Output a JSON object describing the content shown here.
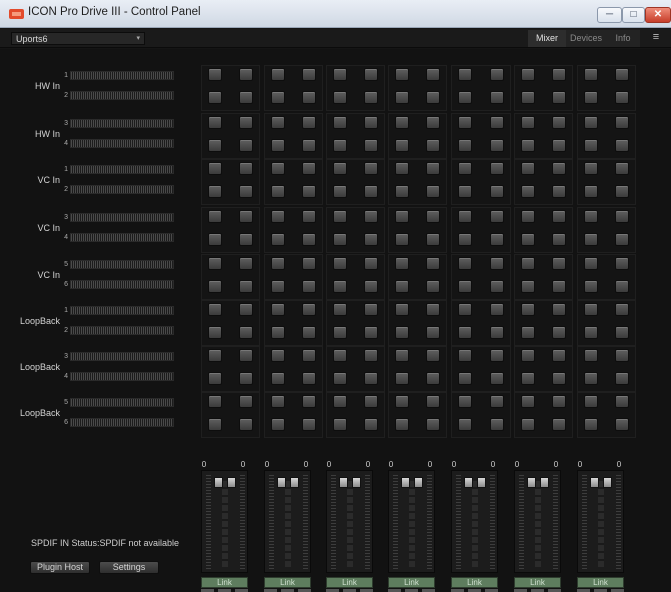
{
  "window": {
    "title": "ICON Pro Drive III - Control Panel",
    "min_glyph": "─",
    "max_glyph": "□",
    "close_glyph": "✕"
  },
  "toolbar": {
    "device": "Uports6",
    "chevron": "▾",
    "tabs": [
      "Mixer",
      "Devices",
      "Info"
    ],
    "active_tab": "Mixer",
    "menu_glyph": "≡"
  },
  "inputs": [
    {
      "label": "HW In",
      "channels": [
        "1",
        "2"
      ]
    },
    {
      "label": "HW In",
      "channels": [
        "3",
        "4"
      ]
    },
    {
      "label": "VC In",
      "channels": [
        "1",
        "2"
      ]
    },
    {
      "label": "VC In",
      "channels": [
        "3",
        "4"
      ]
    },
    {
      "label": "VC In",
      "channels": [
        "5",
        "6"
      ]
    },
    {
      "label": "LoopBack",
      "channels": [
        "1",
        "2"
      ]
    },
    {
      "label": "LoopBack",
      "channels": [
        "3",
        "4"
      ]
    },
    {
      "label": "LoopBack",
      "channels": [
        "5",
        "6"
      ]
    }
  ],
  "outputs": [
    {
      "vol_left": "0",
      "vol_right": "0",
      "link_label": "Link"
    },
    {
      "vol_left": "0",
      "vol_right": "0",
      "link_label": "Link"
    },
    {
      "vol_left": "0",
      "vol_right": "0",
      "link_label": "Link"
    },
    {
      "vol_left": "0",
      "vol_right": "0",
      "link_label": "Link"
    },
    {
      "vol_left": "0",
      "vol_right": "0",
      "link_label": "Link"
    },
    {
      "vol_left": "0",
      "vol_right": "0",
      "link_label": "Link"
    },
    {
      "vol_left": "0",
      "vol_right": "0",
      "link_label": "Link"
    }
  ],
  "spdif_status": "SPDIF IN Status:SPDIF not available",
  "buttons": {
    "plugin_host": "Plugin Host",
    "settings": "Settings"
  }
}
